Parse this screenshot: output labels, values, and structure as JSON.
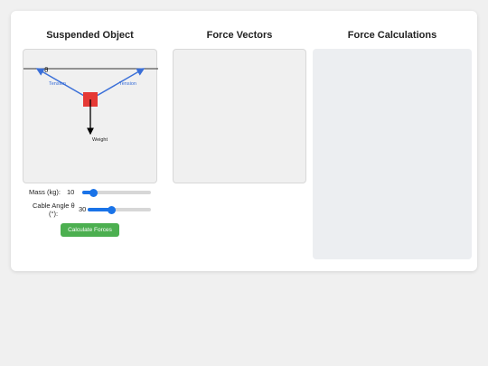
{
  "panels": {
    "scene_title": "Suspended Object",
    "vectors_title": "Force Vectors",
    "calculations_title": "Force Calculations"
  },
  "scene": {
    "angle_symbol": "θ",
    "left_cable_label": "Tension",
    "right_cable_label": "Tension",
    "weight_label": "Weight",
    "colors": {
      "cable": "#3a6fd8",
      "mass": "#e53935",
      "ceiling": "#333333",
      "weight_arrow": "#000000"
    }
  },
  "controls": {
    "mass_label": "Mass (kg):",
    "mass_value": "10",
    "mass_level_fraction": 0.17,
    "angle_label_line1": "Cable Angle θ",
    "angle_label_line2": "(°):",
    "angle_value": "30",
    "angle_level_fraction": 0.38,
    "calculate_button": "Calculate Forces"
  },
  "colors": {
    "accent": "#1a73e8",
    "button": "#4caf50"
  }
}
